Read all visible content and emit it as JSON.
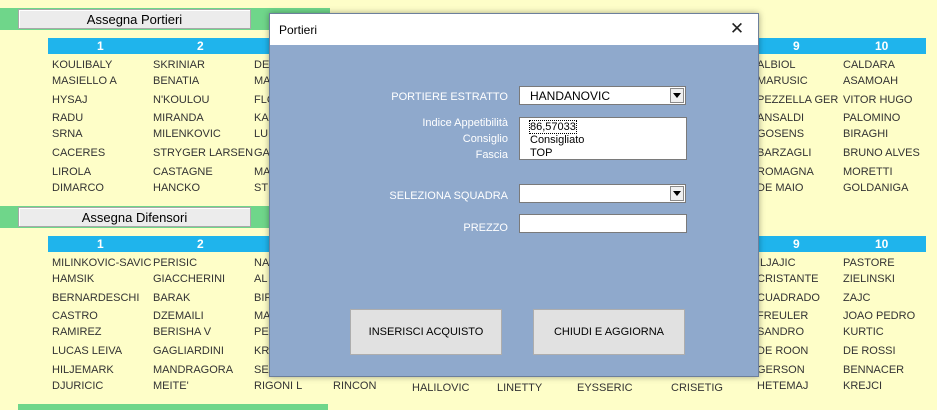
{
  "sheet": {
    "btn_portieri": "Assegna Portieri",
    "btn_difensori": "Assegna Difensori",
    "header_cols": [
      "1",
      "2",
      "9",
      "10"
    ],
    "section1": {
      "col1": [
        "KOULIBALY",
        "MASIELLO A",
        "HYSAJ",
        "RADU",
        "SRNA",
        "CACERES",
        "LIROLA",
        "DIMARCO"
      ],
      "col2": [
        "SKRINIAR",
        "BENATIA",
        "N'KOULOU",
        "MIRANDA",
        "MILENKOVIC",
        "STRYGER LARSEN",
        "CASTAGNE",
        "HANCKO"
      ],
      "col3": [
        "DE",
        "MA",
        "FLO",
        "KA",
        "LU",
        "GA",
        "MA",
        "STI"
      ],
      "col9": [
        "ALBIOL",
        "MARUSIC",
        "PEZZELLA GER",
        "ANSALDI",
        "GOSENS",
        "BARZAGLI",
        "ROMAGNA",
        "DE MAIO"
      ],
      "col10": [
        "CALDARA",
        "ASAMOAH",
        "VITOR HUGO",
        "PALOMINO",
        "BIRAGHI",
        "BRUNO ALVES",
        "MORETTI",
        "GOLDANIGA"
      ]
    },
    "section2": {
      "col1": [
        "MILINKOVIC-SAVIC",
        "HAMSIK",
        "BERNARDESCHI",
        "CASTRO",
        "RAMIREZ",
        "LUCAS LEIVA",
        "HILJEMARK",
        "DJURICIC"
      ],
      "col2": [
        "PERISIC",
        "GIACCHERINI",
        "BARAK",
        "DZEMAILI",
        "BERISHA V",
        "GAGLIARDINI",
        "MANDRAGORA",
        "MEITE'"
      ],
      "col3": [
        "NA",
        "AL",
        "BIR",
        "MA",
        "PE",
        "KR",
        "SE",
        "RIGONI L"
      ],
      "col9": [
        "ILJAJIC",
        "CRISTANTE",
        "CUADRADO",
        "FREULER",
        "SANDRO",
        "DE ROON",
        "GERSON",
        "HETEMAJ"
      ],
      "col10": [
        "PASTORE",
        "ZIELINSKI",
        "ZAJC",
        "JOAO PEDRO",
        "KURTIC",
        "DE ROSSI",
        "BENNACER",
        "KREJCI"
      ],
      "bottom_extra": [
        "RINCON",
        "HALILOVIC",
        "LINETTY",
        "EYSSERIC",
        "CRISETIG"
      ]
    }
  },
  "dialog": {
    "title": "Portieri",
    "close_symbol": "✕",
    "portiere_label": "PORTIERE ESTRATTO",
    "portiere_value": "HANDANOVIC",
    "indice_label": "Indice Appetibilità",
    "consiglio_label": "Consiglio",
    "fascia_label": "Fascia",
    "list_items": [
      "86,57033",
      "Consigliato",
      "TOP"
    ],
    "squadra_label": "SELEZIONA SQUADRA",
    "squadra_value": "",
    "prezzo_label": "PREZZO",
    "prezzo_value": "",
    "btn_inserisci": "INSERISCI ACQUISTO",
    "btn_chiudi": "CHIUDI E AGGIORNA"
  },
  "icons": {
    "dropdown": "chevron-down-icon",
    "close": "close-icon"
  },
  "colors": {
    "sheet_bg": "#fefec8",
    "header_bg": "#1fb4ec",
    "band": "#6fd68a",
    "dialog_bg": "#8fa9cc"
  }
}
